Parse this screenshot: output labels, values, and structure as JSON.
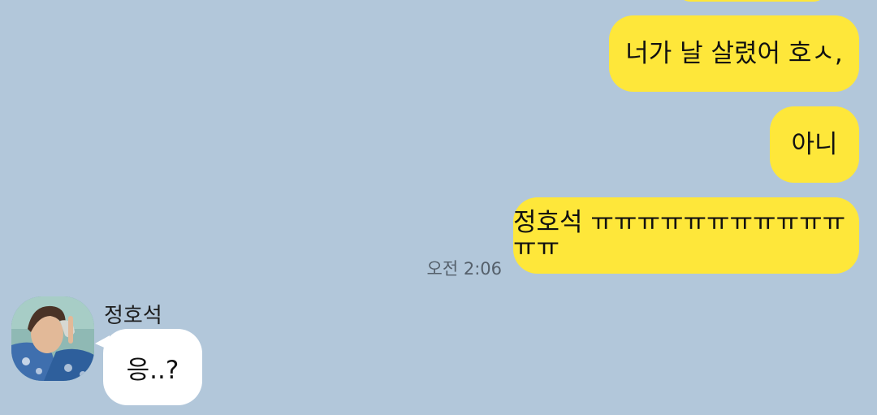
{
  "chat": {
    "outgoing": [
      {
        "text": "너가 날 살렸어 호ㅅ,"
      },
      {
        "text": "아니"
      },
      {
        "text": "정호석 ㅠㅠㅠㅠㅠㅠㅠㅠㅠㅠㅠㅠㅠ"
      }
    ],
    "timestamp": "오전 2:06",
    "incoming": {
      "sender_name": "정호석",
      "text": "응..?"
    }
  },
  "colors": {
    "background": "#b2c7da",
    "outgoing_bubble": "#fee73a",
    "incoming_bubble": "#ffffff"
  },
  "icons": {
    "avatar": "profile-photo"
  }
}
